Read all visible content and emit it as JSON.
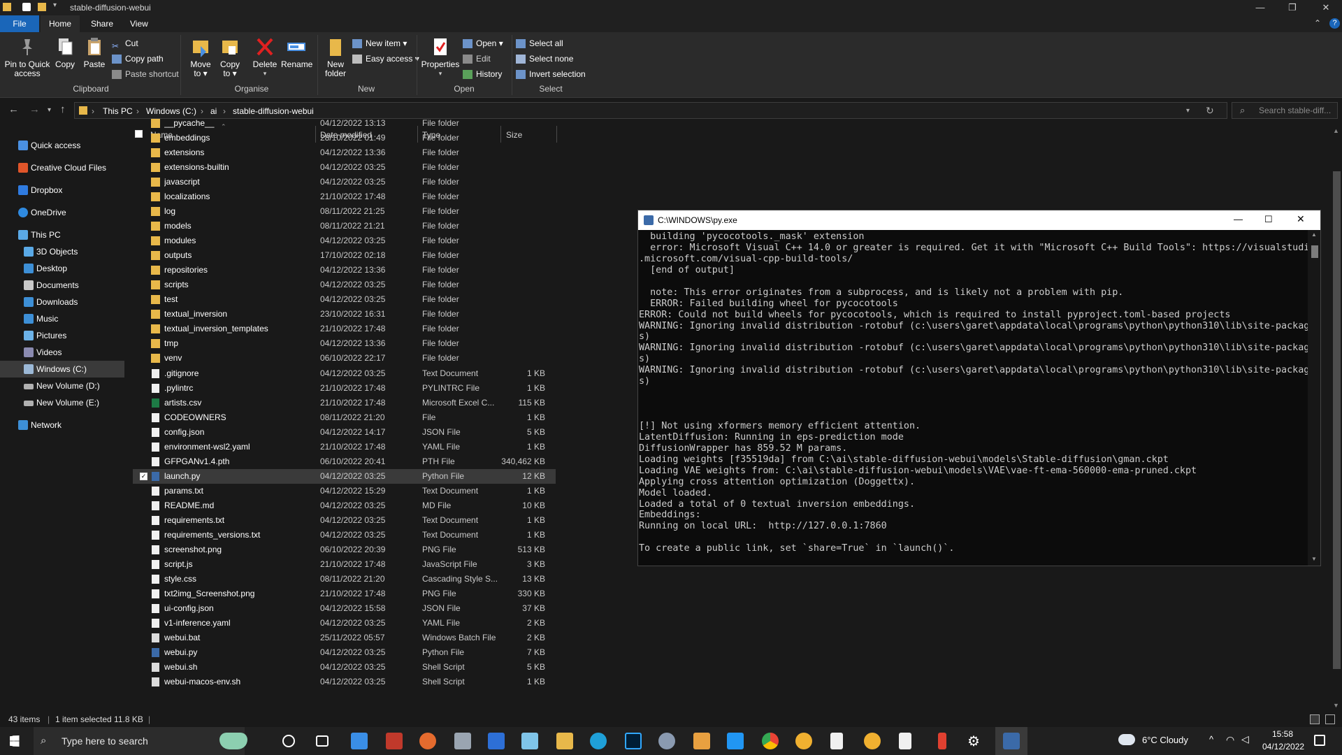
{
  "window": {
    "title": "stable-diffusion-webui"
  },
  "tabs": [
    "File",
    "Home",
    "Share",
    "View"
  ],
  "ribbon": {
    "pin_label_1": "Pin to Quick",
    "pin_label_2": "access",
    "copy": "Copy",
    "paste": "Paste",
    "cut": "Cut",
    "copy_path": "Copy path",
    "paste_shortcut": "Paste shortcut",
    "move_to_1": "Move",
    "move_to_2": "to ▾",
    "copy_to_1": "Copy",
    "copy_to_2": "to ▾",
    "delete": "Delete",
    "rename": "Rename",
    "new_folder_1": "New",
    "new_folder_2": "folder",
    "new_item": "New item ▾",
    "easy_access": "Easy access ▾",
    "properties": "Properties",
    "open": "Open ▾",
    "edit": "Edit",
    "history": "History",
    "select_all": "Select all",
    "select_none": "Select none",
    "invert_selection": "Invert selection",
    "groups": {
      "clipboard": "Clipboard",
      "organise": "Organise",
      "new": "New",
      "open": "Open",
      "select": "Select"
    }
  },
  "address": {
    "crumbs": [
      "This PC",
      "Windows (C:)",
      "ai",
      "stable-diffusion-webui"
    ],
    "search_placeholder": "Search stable-diff..."
  },
  "nav": {
    "quick_access": "Quick access",
    "creative_cloud": "Creative Cloud Files",
    "dropbox": "Dropbox",
    "onedrive": "OneDrive",
    "this_pc": "This PC",
    "objects3d": "3D Objects",
    "desktop": "Desktop",
    "documents": "Documents",
    "downloads": "Downloads",
    "music": "Music",
    "pictures": "Pictures",
    "videos": "Videos",
    "windows_c": "Windows (C:)",
    "new_volume_d": "New Volume (D:)",
    "new_volume_e": "New Volume (E:)",
    "network": "Network"
  },
  "columns": {
    "name": "Name",
    "date": "Date modified",
    "type": "Type",
    "size": "Size"
  },
  "files": [
    {
      "name": "__pycache__",
      "date": "04/12/2022 13:13",
      "type": "File folder",
      "size": "",
      "icon": "folder"
    },
    {
      "name": "embeddings",
      "date": "28/10/2022 01:49",
      "type": "File folder",
      "size": "",
      "icon": "folder"
    },
    {
      "name": "extensions",
      "date": "04/12/2022 13:36",
      "type": "File folder",
      "size": "",
      "icon": "folder"
    },
    {
      "name": "extensions-builtin",
      "date": "04/12/2022 03:25",
      "type": "File folder",
      "size": "",
      "icon": "folder"
    },
    {
      "name": "javascript",
      "date": "04/12/2022 03:25",
      "type": "File folder",
      "size": "",
      "icon": "folder"
    },
    {
      "name": "localizations",
      "date": "21/10/2022 17:48",
      "type": "File folder",
      "size": "",
      "icon": "folder"
    },
    {
      "name": "log",
      "date": "08/11/2022 21:25",
      "type": "File folder",
      "size": "",
      "icon": "folder"
    },
    {
      "name": "models",
      "date": "08/11/2022 21:21",
      "type": "File folder",
      "size": "",
      "icon": "folder"
    },
    {
      "name": "modules",
      "date": "04/12/2022 03:25",
      "type": "File folder",
      "size": "",
      "icon": "folder"
    },
    {
      "name": "outputs",
      "date": "17/10/2022 02:18",
      "type": "File folder",
      "size": "",
      "icon": "folder"
    },
    {
      "name": "repositories",
      "date": "04/12/2022 13:36",
      "type": "File folder",
      "size": "",
      "icon": "folder"
    },
    {
      "name": "scripts",
      "date": "04/12/2022 03:25",
      "type": "File folder",
      "size": "",
      "icon": "folder"
    },
    {
      "name": "test",
      "date": "04/12/2022 03:25",
      "type": "File folder",
      "size": "",
      "icon": "folder"
    },
    {
      "name": "textual_inversion",
      "date": "23/10/2022 16:31",
      "type": "File folder",
      "size": "",
      "icon": "folder"
    },
    {
      "name": "textual_inversion_templates",
      "date": "21/10/2022 17:48",
      "type": "File folder",
      "size": "",
      "icon": "folder"
    },
    {
      "name": "tmp",
      "date": "04/12/2022 13:36",
      "type": "File folder",
      "size": "",
      "icon": "folder"
    },
    {
      "name": "venv",
      "date": "06/10/2022 22:17",
      "type": "File folder",
      "size": "",
      "icon": "folder"
    },
    {
      "name": ".gitignore",
      "date": "04/12/2022 03:25",
      "type": "Text Document",
      "size": "1 KB",
      "icon": "file"
    },
    {
      "name": ".pylintrc",
      "date": "21/10/2022 17:48",
      "type": "PYLINTRC File",
      "size": "1 KB",
      "icon": "file"
    },
    {
      "name": "artists.csv",
      "date": "21/10/2022 17:48",
      "type": "Microsoft Excel C...",
      "size": "115 KB",
      "icon": "excel"
    },
    {
      "name": "CODEOWNERS",
      "date": "08/11/2022 21:20",
      "type": "File",
      "size": "1 KB",
      "icon": "file"
    },
    {
      "name": "config.json",
      "date": "04/12/2022 14:17",
      "type": "JSON File",
      "size": "5 KB",
      "icon": "file"
    },
    {
      "name": "environment-wsl2.yaml",
      "date": "21/10/2022 17:48",
      "type": "YAML File",
      "size": "1 KB",
      "icon": "file"
    },
    {
      "name": "GFPGANv1.4.pth",
      "date": "06/10/2022 20:41",
      "type": "PTH File",
      "size": "340,462 KB",
      "icon": "file"
    },
    {
      "name": "launch.py",
      "date": "04/12/2022 03:25",
      "type": "Python File",
      "size": "12 KB",
      "icon": "python",
      "selected": true
    },
    {
      "name": "params.txt",
      "date": "04/12/2022 15:29",
      "type": "Text Document",
      "size": "1 KB",
      "icon": "file"
    },
    {
      "name": "README.md",
      "date": "04/12/2022 03:25",
      "type": "MD File",
      "size": "10 KB",
      "icon": "file"
    },
    {
      "name": "requirements.txt",
      "date": "04/12/2022 03:25",
      "type": "Text Document",
      "size": "1 KB",
      "icon": "file"
    },
    {
      "name": "requirements_versions.txt",
      "date": "04/12/2022 03:25",
      "type": "Text Document",
      "size": "1 KB",
      "icon": "file"
    },
    {
      "name": "screenshot.png",
      "date": "06/10/2022 20:39",
      "type": "PNG File",
      "size": "513 KB",
      "icon": "image"
    },
    {
      "name": "script.js",
      "date": "21/10/2022 17:48",
      "type": "JavaScript File",
      "size": "3 KB",
      "icon": "script"
    },
    {
      "name": "style.css",
      "date": "08/11/2022 21:20",
      "type": "Cascading Style S...",
      "size": "13 KB",
      "icon": "script"
    },
    {
      "name": "txt2img_Screenshot.png",
      "date": "21/10/2022 17:48",
      "type": "PNG File",
      "size": "330 KB",
      "icon": "image"
    },
    {
      "name": "ui-config.json",
      "date": "04/12/2022 15:58",
      "type": "JSON File",
      "size": "37 KB",
      "icon": "file"
    },
    {
      "name": "v1-inference.yaml",
      "date": "04/12/2022 03:25",
      "type": "YAML File",
      "size": "2 KB",
      "icon": "file"
    },
    {
      "name": "webui.bat",
      "date": "25/11/2022 05:57",
      "type": "Windows Batch File",
      "size": "2 KB",
      "icon": "batch"
    },
    {
      "name": "webui.py",
      "date": "04/12/2022 03:25",
      "type": "Python File",
      "size": "7 KB",
      "icon": "python"
    },
    {
      "name": "webui.sh",
      "date": "04/12/2022 03:25",
      "type": "Shell Script",
      "size": "5 KB",
      "icon": "batch"
    },
    {
      "name": "webui-macos-env.sh",
      "date": "04/12/2022 03:25",
      "type": "Shell Script",
      "size": "1 KB",
      "icon": "batch"
    }
  ],
  "status": {
    "items": "43 items",
    "selected": "1 item selected  11.8 KB"
  },
  "console": {
    "title": "C:\\WINDOWS\\py.exe",
    "lines": [
      "  building 'pycocotools._mask' extension",
      "  error: Microsoft Visual C++ 14.0 or greater is required. Get it with \"Microsoft C++ Build Tools\": https://visualstudio",
      ".microsoft.com/visual-cpp-build-tools/",
      "  [end of output]",
      "",
      "  note: This error originates from a subprocess, and is likely not a problem with pip.",
      "  ERROR: Failed building wheel for pycocotools",
      "ERROR: Could not build wheels for pycocotools, which is required to install pyproject.toml-based projects",
      "WARNING: Ignoring invalid distribution -rotobuf (c:\\users\\garet\\appdata\\local\\programs\\python\\python310\\lib\\site-package",
      "s)",
      "WARNING: Ignoring invalid distribution -rotobuf (c:\\users\\garet\\appdata\\local\\programs\\python\\python310\\lib\\site-package",
      "s)",
      "WARNING: Ignoring invalid distribution -rotobuf (c:\\users\\garet\\appdata\\local\\programs\\python\\python310\\lib\\site-package",
      "s)",
      "",
      "",
      "",
      "[!] Not using xformers memory efficient attention.",
      "LatentDiffusion: Running in eps-prediction mode",
      "DiffusionWrapper has 859.52 M params.",
      "Loading weights [f35519da] from C:\\ai\\stable-diffusion-webui\\models\\Stable-diffusion\\gman.ckpt",
      "Loading VAE weights from: C:\\ai\\stable-diffusion-webui\\models\\VAE\\vae-ft-ema-560000-ema-pruned.ckpt",
      "Applying cross attention optimization (Doggettx).",
      "Model loaded.",
      "Loaded a total of 0 textual inversion embeddings.",
      "Embeddings:",
      "Running on local URL:  http://127.0.0.1:7860",
      "",
      "To create a public link, set `share=True` in `launch()`."
    ]
  },
  "taskbar": {
    "search_placeholder": "Type here to search",
    "weather": "6°C  Cloudy",
    "time": "15:58",
    "date": "04/12/2022"
  },
  "colors": {
    "folder": "#e8b84a",
    "accent": "#1a66b9",
    "selection": "#3a3a3a"
  }
}
